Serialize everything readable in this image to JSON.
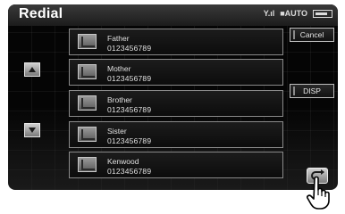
{
  "header": {
    "title": "Redial"
  },
  "status": {
    "signal": "Y.ıl",
    "auto": "■AUTO"
  },
  "contacts": [
    {
      "name": "Father",
      "number": "0123456789"
    },
    {
      "name": "Mother",
      "number": "0123456789"
    },
    {
      "name": "Brother",
      "number": "0123456789"
    },
    {
      "name": "Sister",
      "number": "0123456789"
    },
    {
      "name": "Kenwood",
      "number": "0123456789"
    }
  ],
  "buttons": {
    "cancel": "Cancel",
    "disp": "DISP"
  },
  "icons": {
    "scroll_up": "up-arrow-icon",
    "scroll_down": "down-arrow-icon",
    "contact": "contact-icon",
    "return": "return-icon",
    "pointer": "pointing-hand-icon"
  }
}
